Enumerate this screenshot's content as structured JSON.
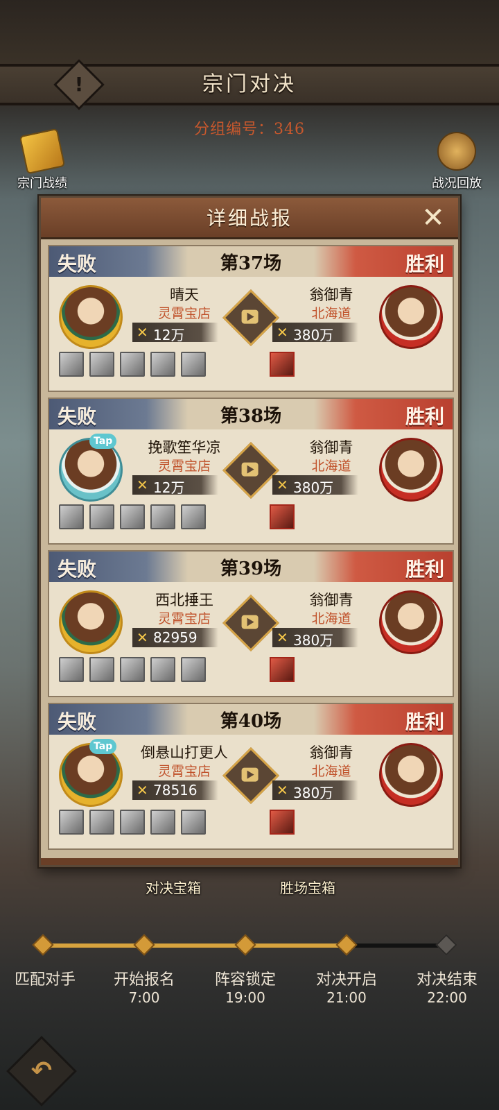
{
  "header": {
    "title": "宗门对决",
    "group_number": "分组编号：346",
    "left_button": "宗门战绩",
    "right_button": "战况回放"
  },
  "modal": {
    "title": "详细战报",
    "lose_label": "失败",
    "win_label": "胜利",
    "matches": [
      {
        "round": "第37场",
        "left": {
          "name": "晴天",
          "guild": "灵霄宝店",
          "power": "12万"
        },
        "right": {
          "name": "翁御青",
          "guild": "北海道",
          "power": "380万"
        }
      },
      {
        "round": "第38场",
        "left": {
          "name": "挽歌笙华凉",
          "guild": "灵霄宝店",
          "power": "12万"
        },
        "right": {
          "name": "翁御青",
          "guild": "北海道",
          "power": "380万"
        }
      },
      {
        "round": "第39场",
        "left": {
          "name": "西北捶王",
          "guild": "灵霄宝店",
          "power": "82959"
        },
        "right": {
          "name": "翁御青",
          "guild": "北海道",
          "power": "380万"
        }
      },
      {
        "round": "第40场",
        "left": {
          "name": "倒悬山打更人",
          "guild": "灵霄宝店",
          "power": "78516"
        },
        "right": {
          "name": "翁御青",
          "guild": "北海道",
          "power": "380万"
        }
      }
    ],
    "tap_badge": "Tap"
  },
  "chests": {
    "left": "对决宝箱",
    "right": "胜场宝箱"
  },
  "timeline": {
    "progress": 0.75,
    "stages": [
      {
        "label": "匹配对手",
        "time": ""
      },
      {
        "label": "开始报名",
        "time": "7:00"
      },
      {
        "label": "阵容锁定",
        "time": "19:00"
      },
      {
        "label": "对决开启",
        "time": "21:00"
      },
      {
        "label": "对决结束",
        "time": "22:00"
      }
    ]
  },
  "colors": {
    "win": "#cf5a43",
    "lose": "#6c7a92",
    "guild_text": "#c0512a",
    "accent": "#d7a33e"
  },
  "icons": {
    "alert": "exclamation-icon",
    "close": "close-icon",
    "play": "video-replay-icon",
    "power": "crossed-swords-icon",
    "back": "back-arrow-icon"
  }
}
